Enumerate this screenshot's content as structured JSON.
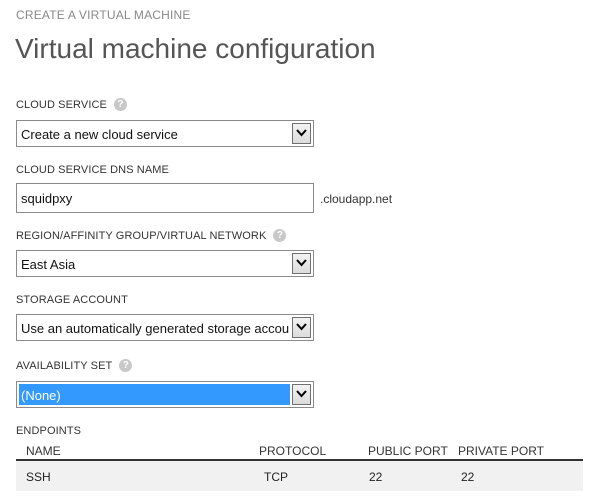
{
  "wizard": {
    "step_title": "CREATE A VIRTUAL MACHINE",
    "page_title": "Virtual machine configuration"
  },
  "cloud_service": {
    "label": "CLOUD SERVICE",
    "selected": "Create a new cloud service"
  },
  "dns_name": {
    "label": "CLOUD SERVICE DNS NAME",
    "value": "squidpxy",
    "suffix": ".cloudapp.net"
  },
  "region": {
    "label": "REGION/AFFINITY GROUP/VIRTUAL NETWORK",
    "selected": "East Asia"
  },
  "storage": {
    "label": "STORAGE ACCOUNT",
    "selected": "Use an automatically generated storage account"
  },
  "availability": {
    "label": "AVAILABILITY SET",
    "selected": "(None)"
  },
  "endpoints": {
    "label": "ENDPOINTS",
    "columns": {
      "name": "NAME",
      "protocol": "PROTOCOL",
      "public_port": "PUBLIC PORT",
      "private_port": "PRIVATE PORT"
    },
    "rows": [
      {
        "name": "SSH",
        "protocol": "TCP",
        "public_port": "22",
        "private_port": "22"
      }
    ]
  },
  "icons": {
    "help": "help-icon",
    "dropdown": "chevron-down-icon"
  },
  "colors": {
    "selection": "#3399ff",
    "title": "#555555",
    "help_icon": "#c8c8c8"
  }
}
